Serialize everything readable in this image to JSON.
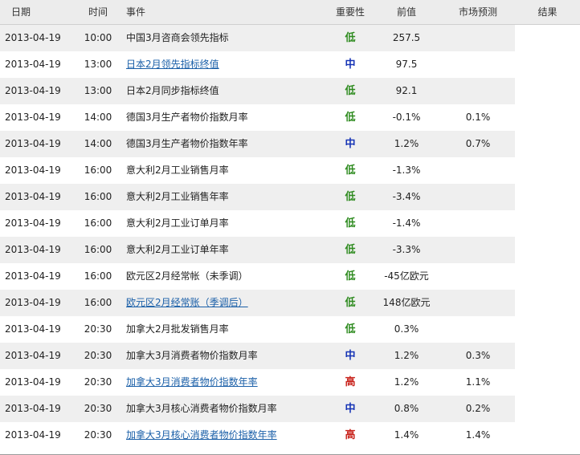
{
  "colors": {
    "importance_low": "#2e8b1f",
    "importance_mid": "#1533b5",
    "importance_high": "#c8231c",
    "link": "#1a5fa8",
    "row_alt_bg": "#efefef",
    "header_bg": "#ececec"
  },
  "header": {
    "date": "日期",
    "time": "时间",
    "event": "事件",
    "importance": "重要性",
    "previous": "前值",
    "forecast": "市场预测",
    "result": "结果"
  },
  "rows": [
    {
      "date": "2013-04-19",
      "time": "10:00",
      "event": "中国3月咨商会领先指标",
      "link": false,
      "importance": "低",
      "level": "low",
      "previous": "257.5",
      "forecast": "",
      "result": ""
    },
    {
      "date": "2013-04-19",
      "time": "13:00",
      "event": "日本2月领先指标终值",
      "link": true,
      "importance": "中",
      "level": "mid",
      "previous": "97.5",
      "forecast": "",
      "result": ""
    },
    {
      "date": "2013-04-19",
      "time": "13:00",
      "event": "日本2月同步指标终值",
      "link": false,
      "importance": "低",
      "level": "low",
      "previous": "92.1",
      "forecast": "",
      "result": ""
    },
    {
      "date": "2013-04-19",
      "time": "14:00",
      "event": "德国3月生产者物价指数月率",
      "link": false,
      "importance": "低",
      "level": "low",
      "previous": "-0.1%",
      "forecast": "0.1%",
      "result": ""
    },
    {
      "date": "2013-04-19",
      "time": "14:00",
      "event": "德国3月生产者物价指数年率",
      "link": false,
      "importance": "中",
      "level": "mid",
      "previous": "1.2%",
      "forecast": "0.7%",
      "result": ""
    },
    {
      "date": "2013-04-19",
      "time": "16:00",
      "event": "意大利2月工业销售月率",
      "link": false,
      "importance": "低",
      "level": "low",
      "previous": "-1.3%",
      "forecast": "",
      "result": ""
    },
    {
      "date": "2013-04-19",
      "time": "16:00",
      "event": "意大利2月工业销售年率",
      "link": false,
      "importance": "低",
      "level": "low",
      "previous": "-3.4%",
      "forecast": "",
      "result": ""
    },
    {
      "date": "2013-04-19",
      "time": "16:00",
      "event": "意大利2月工业订单月率",
      "link": false,
      "importance": "低",
      "level": "low",
      "previous": "-1.4%",
      "forecast": "",
      "result": ""
    },
    {
      "date": "2013-04-19",
      "time": "16:00",
      "event": "意大利2月工业订单年率",
      "link": false,
      "importance": "低",
      "level": "low",
      "previous": "-3.3%",
      "forecast": "",
      "result": ""
    },
    {
      "date": "2013-04-19",
      "time": "16:00",
      "event": "欧元区2月经常帐（未季调）",
      "link": false,
      "importance": "低",
      "level": "low",
      "previous": "-45亿欧元",
      "forecast": "",
      "result": ""
    },
    {
      "date": "2013-04-19",
      "time": "16:00",
      "event": "欧元区2月经常账（季调后）",
      "link": true,
      "importance": "低",
      "level": "low",
      "previous": "148亿欧元",
      "forecast": "",
      "result": ""
    },
    {
      "date": "2013-04-19",
      "time": "20:30",
      "event": "加拿大2月批发销售月率",
      "link": false,
      "importance": "低",
      "level": "low",
      "previous": "0.3%",
      "forecast": "",
      "result": ""
    },
    {
      "date": "2013-04-19",
      "time": "20:30",
      "event": "加拿大3月消费者物价指数月率",
      "link": false,
      "importance": "中",
      "level": "mid",
      "previous": "1.2%",
      "forecast": "0.3%",
      "result": ""
    },
    {
      "date": "2013-04-19",
      "time": "20:30",
      "event": "加拿大3月消费者物价指数年率",
      "link": true,
      "importance": "高",
      "level": "high",
      "previous": "1.2%",
      "forecast": "1.1%",
      "result": ""
    },
    {
      "date": "2013-04-19",
      "time": "20:30",
      "event": "加拿大3月核心消费者物价指数月率",
      "link": false,
      "importance": "中",
      "level": "mid",
      "previous": "0.8%",
      "forecast": "0.2%",
      "result": ""
    },
    {
      "date": "2013-04-19",
      "time": "20:30",
      "event": "加拿大3月核心消费者物价指数年率",
      "link": true,
      "importance": "高",
      "level": "high",
      "previous": "1.4%",
      "forecast": "1.4%",
      "result": ""
    }
  ]
}
